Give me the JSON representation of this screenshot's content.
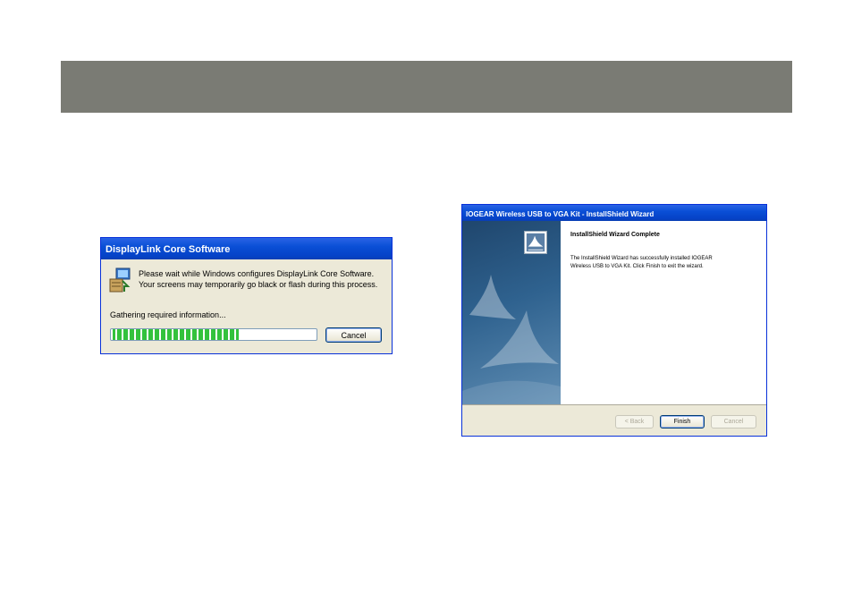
{
  "banner": {
    "color": "#7a7b74"
  },
  "dialog1": {
    "title": "DisplayLink Core Software",
    "message_line1": "Please wait while Windows configures DisplayLink Core Software.",
    "message_line2": "Your screens may temporarily go black or flash during this process.",
    "status": "Gathering required information...",
    "progress": 0.62,
    "cancel_label": "Cancel",
    "icon": "installer-icon"
  },
  "dialog2": {
    "title": "IOGEAR Wireless USB to VGA Kit - InstallShield Wizard",
    "heading": "InstallShield Wizard Complete",
    "body_line1": "The InstallShield Wizard has successfully installed IOGEAR",
    "body_line2": "Wireless USB to VGA Kit.  Click Finish to exit the wizard.",
    "back_label": "< Back",
    "finish_label": "Finish",
    "cancel_label": "Cancel",
    "icon": "installshield-logo-icon"
  }
}
